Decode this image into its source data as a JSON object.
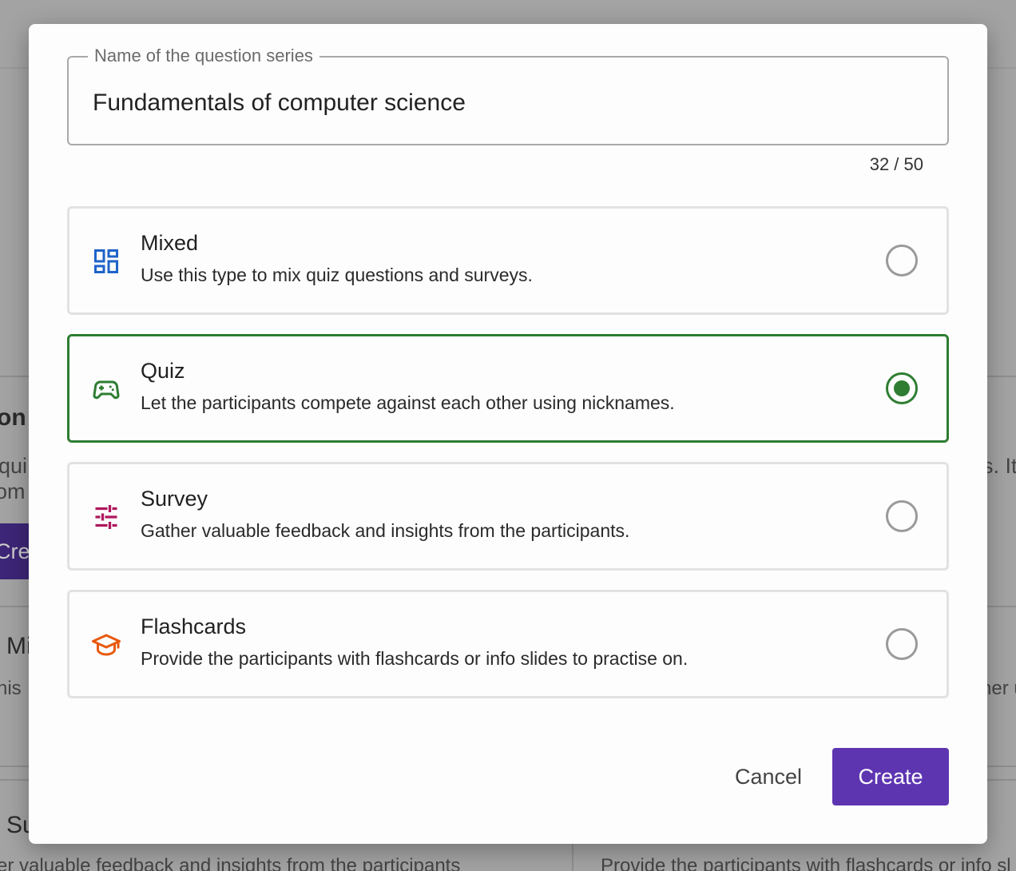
{
  "background": {
    "heading_fragment": "on",
    "text_fragment_1": "qui",
    "text_fragment_2": "om",
    "button_fragment": "Crea",
    "card_title_fragment": "Mi",
    "card_desc_fragment": "his",
    "card2_title_fragment": "Su",
    "bottom_left_text": "er valuable feedback and insights from the participants",
    "right_fragment_1": "s. It",
    "right_fragment_2": "her u",
    "bottom_right_text": "Provide the participants with flashcards or info sl"
  },
  "dialog": {
    "name_field": {
      "label": "Name of the question series",
      "value": "Fundamentals of computer science",
      "counter": "32 / 50"
    },
    "options": [
      {
        "title": "Mixed",
        "description": "Use this type to mix quiz questions and surveys.",
        "icon": "dashboard-icon",
        "color": "#1e63c9",
        "selected": false
      },
      {
        "title": "Quiz",
        "description": "Let the participants compete against each other using nicknames.",
        "icon": "gamepad-icon",
        "color": "#2e7d32",
        "selected": true
      },
      {
        "title": "Survey",
        "description": "Gather valuable feedback and insights from the participants.",
        "icon": "tune-icon",
        "color": "#b0175e",
        "selected": false
      },
      {
        "title": "Flashcards",
        "description": "Provide the participants with flashcards or info slides to practise on.",
        "icon": "school-icon",
        "color": "#e8590c",
        "selected": false
      }
    ],
    "cancel_label": "Cancel",
    "create_label": "Create"
  }
}
